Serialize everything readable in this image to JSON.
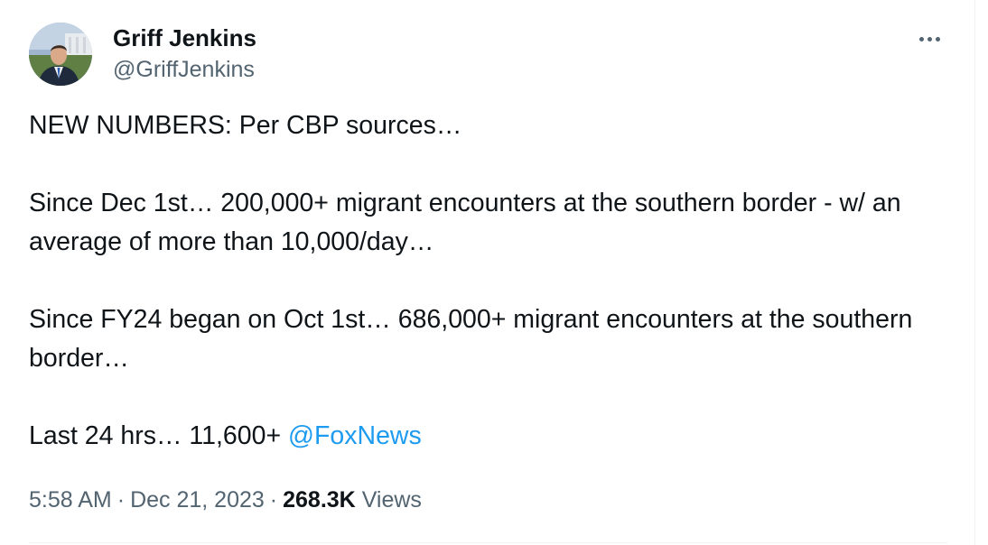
{
  "author": {
    "display_name": "Griff Jenkins",
    "handle": "@GriffJenkins"
  },
  "more_button": {
    "icon": "more-horizontal-icon"
  },
  "tweet": {
    "line1": "NEW NUMBERS: Per CBP sources…",
    "line2": "Since Dec 1st… 200,000+ migrant encounters at the southern border - w/ an average of more than 10,000/day…",
    "line3": "Since FY24 began on Oct 1st… 686,000+ migrant encounters at the southern border…",
    "line4_prefix": "Last 24 hrs… 11,600+ ",
    "mention": "@FoxNews"
  },
  "meta": {
    "time": "5:58 AM",
    "separator": "·",
    "date": "Dec 21, 2023",
    "views_count": "268.3K",
    "views_label": "Views"
  },
  "colors": {
    "link": "#1d9bf0",
    "secondary_text": "#536471",
    "primary_text": "#0f1419"
  }
}
